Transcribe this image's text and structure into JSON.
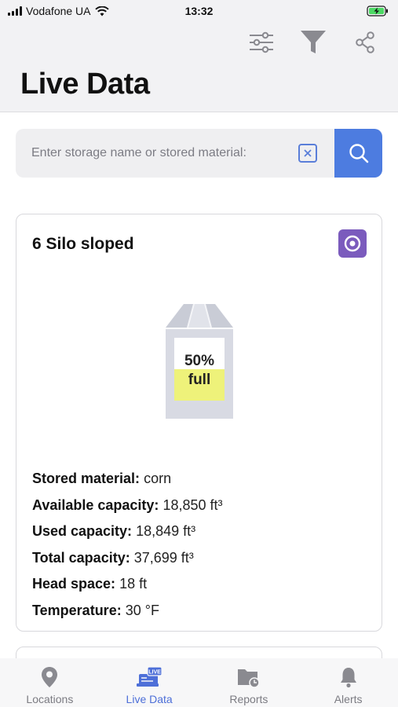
{
  "status_bar": {
    "carrier": "Vodafone UA",
    "time": "13:32"
  },
  "header": {
    "title": "Live Data",
    "toolbar": [
      {
        "icon": "sliders-icon"
      },
      {
        "icon": "filter-icon"
      },
      {
        "icon": "share-icon"
      }
    ]
  },
  "search": {
    "placeholder": "Enter storage name or stored material:",
    "value": ""
  },
  "storage_card": {
    "name": "6 Silo sloped",
    "fill_percent": 50,
    "fill_label_line1": "50%",
    "fill_label_line2": "full",
    "details": [
      {
        "label": "Stored material:",
        "value": "corn"
      },
      {
        "label": "Available capacity:",
        "value": "18,850 ft³"
      },
      {
        "label": "Used capacity:",
        "value": "18,849 ft³"
      },
      {
        "label": "Total capacity:",
        "value": "37,699 ft³"
      },
      {
        "label": "Head space:",
        "value": "18 ft"
      },
      {
        "label": "Temperature:",
        "value": "30 °F"
      }
    ]
  },
  "tabbar": {
    "tabs": [
      {
        "label": "Locations",
        "icon": "location-pin-icon",
        "active": false
      },
      {
        "label": "Live Data",
        "icon": "live-data-icon",
        "active": true
      },
      {
        "label": "Reports",
        "icon": "reports-icon",
        "active": false
      },
      {
        "label": "Alerts",
        "icon": "bell-icon",
        "active": false
      }
    ]
  },
  "colors": {
    "accent": "#4d7ce0",
    "sensor_badge": "#7b5bbd",
    "fill_yellow": "#eef27a"
  }
}
